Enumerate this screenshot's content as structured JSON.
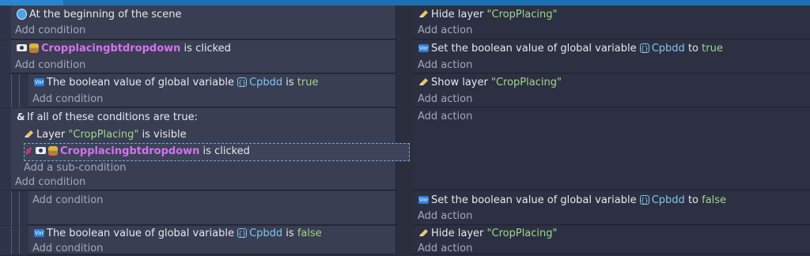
{
  "events": [
    {
      "conditions": [
        {
          "icon": "scene-start-icon",
          "text": "At the beginning of the scene"
        }
      ],
      "add_condition": "Add condition",
      "actions": [
        {
          "icon": "layer-icon",
          "pre": "Hide layer ",
          "string": "\"CropPlacing\""
        }
      ],
      "add_action": "Add action"
    },
    {
      "conditions": [
        {
          "object": "Cropplacingbtdropdown",
          "post": " is clicked"
        }
      ],
      "add_condition": "Add condition",
      "actions": [
        {
          "pre": "Set the boolean value of global variable ",
          "var": "Cpbdd",
          "mid": " to ",
          "value": "true"
        }
      ],
      "add_action": "Add action"
    },
    {
      "conditions": [
        {
          "pre": "The boolean value of global variable ",
          "var": "Cpbdd",
          "mid": " is ",
          "value": "true"
        }
      ],
      "add_condition": "Add condition",
      "actions": [
        {
          "pre": "Show layer ",
          "string": "\"CropPlacing\""
        }
      ],
      "add_action": "Add action"
    },
    {
      "conditions": [
        {
          "text": "If all of these conditions are true:"
        },
        {
          "pre": "Layer ",
          "string": "\"CropPlacing\"",
          "post": " is visible"
        },
        {
          "object": "Cropplacingbtdropdown",
          "post": " is clicked"
        }
      ],
      "add_subcondition": "Add a sub-condition",
      "add_condition": "Add condition",
      "add_action": "Add action"
    },
    {
      "add_condition": "Add condition",
      "actions": [
        {
          "pre": "Set the boolean value of global variable ",
          "var": "Cpbdd",
          "mid": " to ",
          "value": "false"
        }
      ],
      "add_action": "Add action"
    },
    {
      "conditions": [
        {
          "pre": "The boolean value of global variable ",
          "var": "Cpbdd",
          "mid": " is ",
          "value": "false"
        }
      ],
      "add_condition": "Add condition",
      "actions": [
        {
          "pre": "Hide layer ",
          "string": "\"CropPlacing\""
        }
      ],
      "add_action": "Add action"
    }
  ],
  "colors": {
    "background": "#2a2e3d",
    "condition_bg": "#393e52",
    "action_bg": "#2c3042",
    "object_name": "#d472f0",
    "string_value": "#9fd68a",
    "variable_name": "#7ec6f0",
    "accent": "#1d6fb3"
  }
}
